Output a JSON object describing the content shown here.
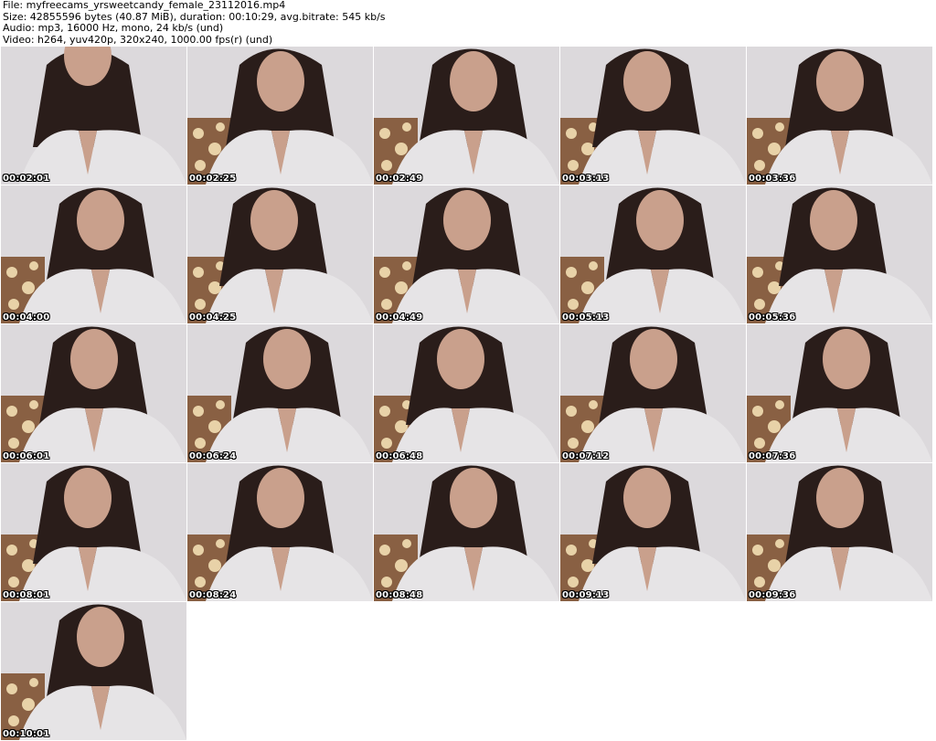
{
  "header": {
    "line1": "File: myfreecams_yrsweetcandy_female_23112016.mp4",
    "line2": "Size: 42855596 bytes (40.87 MiB), duration: 00:10:29, avg.bitrate: 545 kb/s",
    "line3": "Audio: mp3, 16000 Hz, mono, 24 kb/s (und)",
    "line4": "Video: h264, yuv420p, 320x240, 1000.00 fps(r) (und)"
  },
  "colors": {
    "wall": "#dcd9dc",
    "robe": "#e6e4e6",
    "hair": "#2a1d1a",
    "skin": "#c9a08c",
    "pattern": "#7a4a28"
  },
  "thumbnails": [
    {
      "timestamp": "00:02:01"
    },
    {
      "timestamp": "00:02:25"
    },
    {
      "timestamp": "00:02:49"
    },
    {
      "timestamp": "00:03:13"
    },
    {
      "timestamp": "00:03:36"
    },
    {
      "timestamp": "00:04:00"
    },
    {
      "timestamp": "00:04:25"
    },
    {
      "timestamp": "00:04:49"
    },
    {
      "timestamp": "00:05:13"
    },
    {
      "timestamp": "00:05:36"
    },
    {
      "timestamp": "00:06:01"
    },
    {
      "timestamp": "00:06:24"
    },
    {
      "timestamp": "00:06:48"
    },
    {
      "timestamp": "00:07:12"
    },
    {
      "timestamp": "00:07:36"
    },
    {
      "timestamp": "00:08:01"
    },
    {
      "timestamp": "00:08:24"
    },
    {
      "timestamp": "00:08:48"
    },
    {
      "timestamp": "00:09:13"
    },
    {
      "timestamp": "00:09:36"
    },
    {
      "timestamp": "00:10:01"
    }
  ]
}
